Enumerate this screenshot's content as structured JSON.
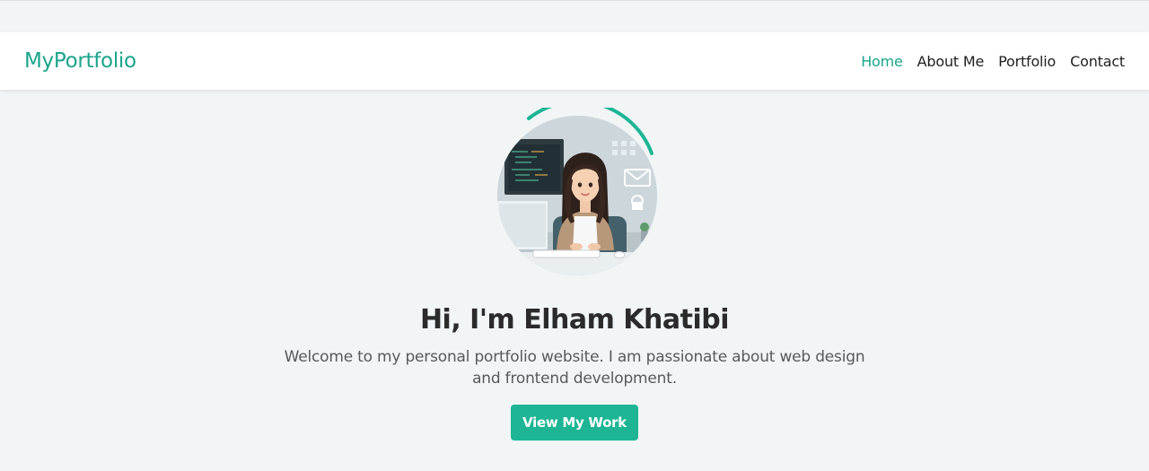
{
  "brand": {
    "name": "MyPortfolio"
  },
  "nav": {
    "items": [
      {
        "label": "Home",
        "active": true
      },
      {
        "label": "About Me",
        "active": false
      },
      {
        "label": "Portfolio",
        "active": false
      },
      {
        "label": "Contact",
        "active": false
      }
    ]
  },
  "hero": {
    "title": "Hi, I'm Elham Khatibi",
    "description": "Welcome to my personal portfolio website. I am passionate about web design and frontend development.",
    "cta_label": "View My Work"
  },
  "colors": {
    "accent": "#1aa58b",
    "button": "#1db594",
    "background": "#f1f5f6",
    "navbar": "#ffffff"
  }
}
